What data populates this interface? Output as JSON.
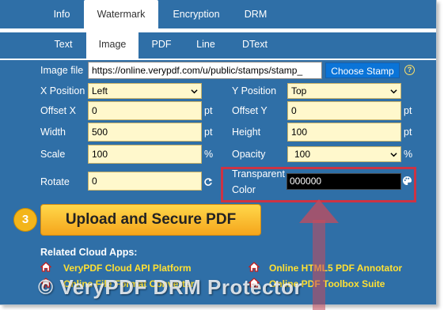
{
  "tabs_main": [
    {
      "label": "Info"
    },
    {
      "label": "Watermark"
    },
    {
      "label": "Encryption"
    },
    {
      "label": "DRM"
    }
  ],
  "tabs_watermark": [
    {
      "label": "Text"
    },
    {
      "label": "Image"
    },
    {
      "label": "PDF"
    },
    {
      "label": "Line"
    },
    {
      "label": "DText"
    }
  ],
  "form": {
    "image_file": {
      "label": "Image file",
      "value": "https://online.verypdf.com/u/public/stamps/stamp_"
    },
    "choose_stamp": "Choose Stamp",
    "help_glyph": "?",
    "x_position": {
      "label": "X Position",
      "value": "Left"
    },
    "y_position": {
      "label": "Y Position",
      "value": "Top"
    },
    "offset_x": {
      "label": "Offset X",
      "value": "0",
      "unit": "pt"
    },
    "offset_y": {
      "label": "Offset Y",
      "value": "0",
      "unit": "pt"
    },
    "width": {
      "label": "Width",
      "value": "500",
      "unit": "pt"
    },
    "height": {
      "label": "Height",
      "value": "100",
      "unit": "pt"
    },
    "scale": {
      "label": "Scale",
      "value": "100",
      "unit": "%"
    },
    "opacity": {
      "label": "Opacity",
      "value": "100",
      "unit": "%"
    },
    "rotate": {
      "label": "Rotate",
      "value": "0"
    },
    "transparent_color": {
      "label_line1": "Transparent",
      "label_line2": "Color",
      "value": "000000"
    }
  },
  "step_badge": "3",
  "upload_button": "Upload and Secure PDF",
  "related": {
    "heading": "Related Cloud Apps:",
    "apps": [
      {
        "label": "VeryPDF Cloud API Platform"
      },
      {
        "label": "Online HTML5 PDF Annotator"
      },
      {
        "label": "Online File Format Converter"
      },
      {
        "label": "Online PDF Toolbox Suite"
      }
    ]
  },
  "watermark_text": "© VeryPDF DRM Protector",
  "colors": {
    "panel": "#2f6fa7",
    "input_bg": "#fff8cc",
    "accent_yellow": "#ffe033",
    "highlight_red": "#cc3344",
    "stamp_button": "#0a74d8"
  },
  "icons": {
    "help": "question-circle-icon",
    "rotate_refresh": "refresh-icon",
    "color_picker": "palette-icon",
    "app": "house-icon"
  }
}
